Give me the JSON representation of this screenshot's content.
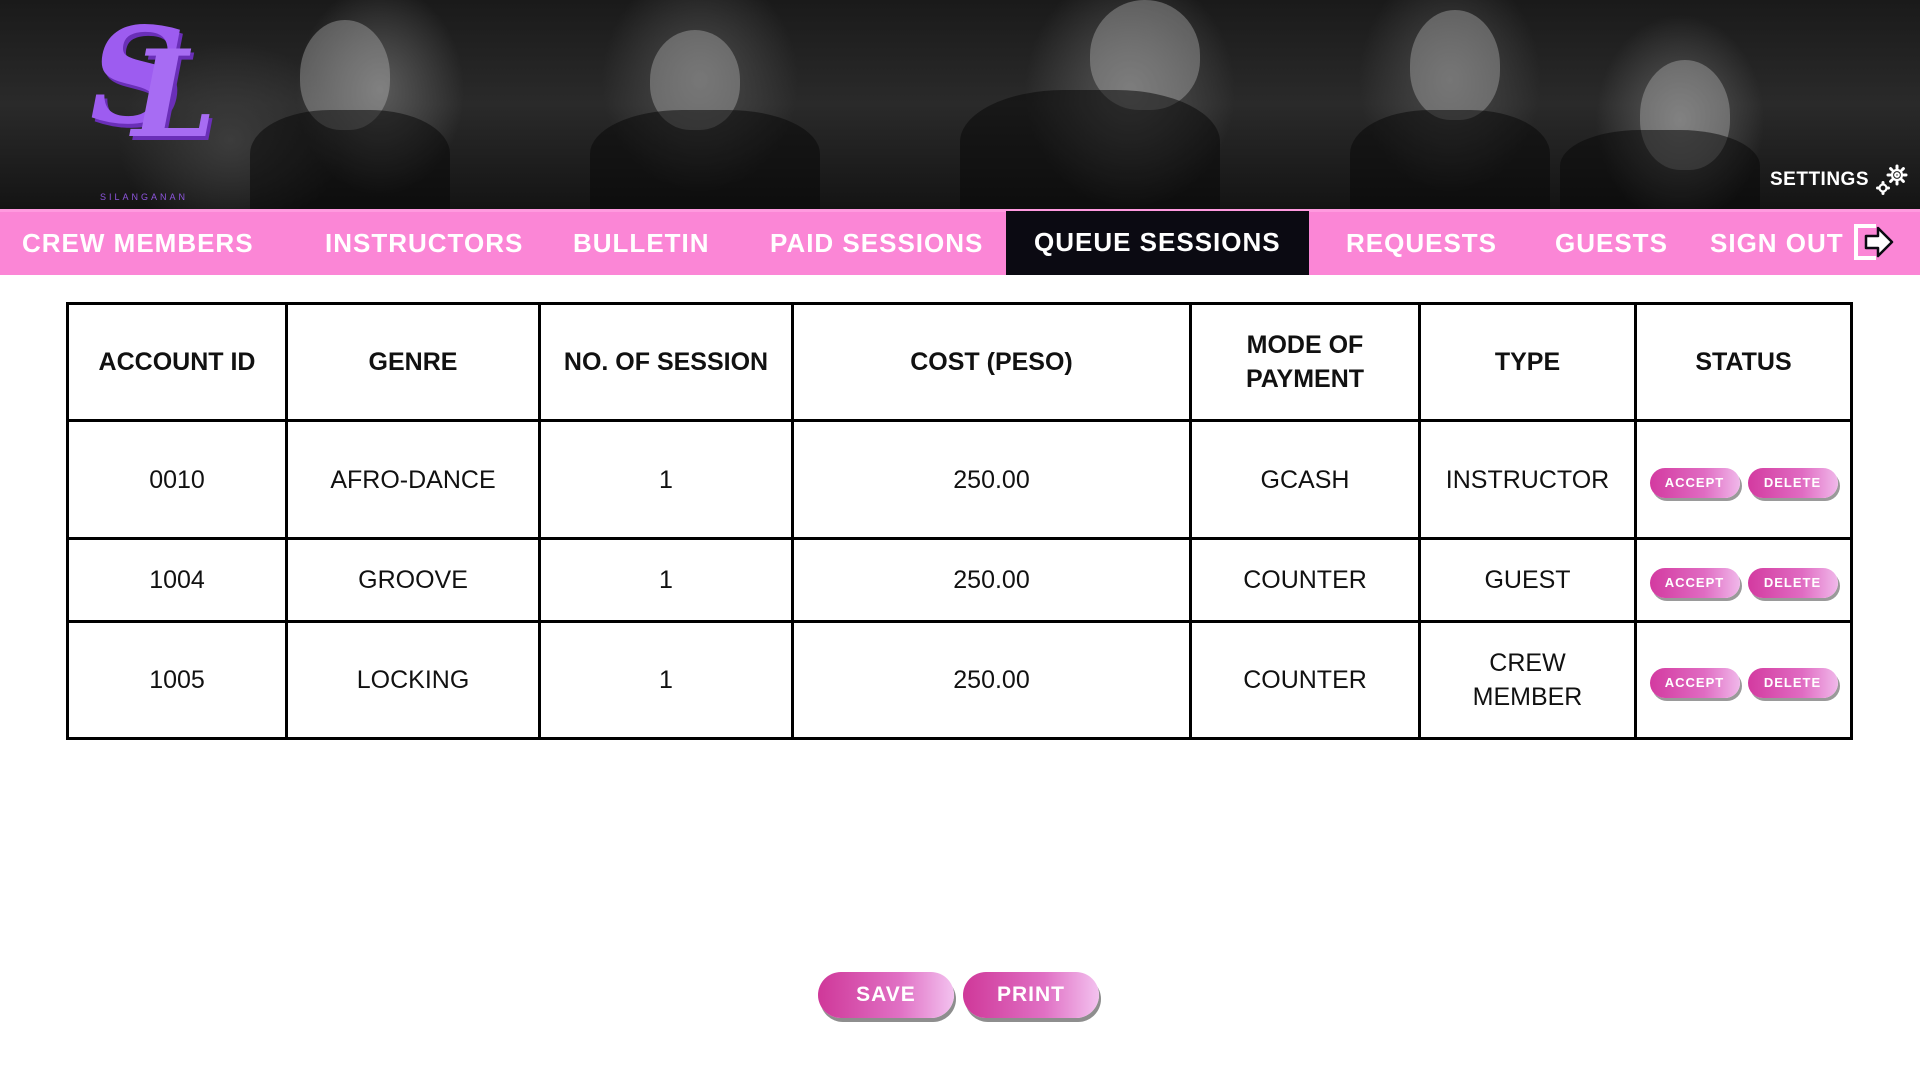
{
  "logo": {
    "mark": "SL",
    "subtitle": "SILANGANAN"
  },
  "settings": {
    "label": "SETTINGS",
    "icon": "gear-icon"
  },
  "nav": {
    "items": [
      {
        "label": "CREW MEMBERS"
      },
      {
        "label": "INSTRUCTORS"
      },
      {
        "label": "BULLETIN"
      },
      {
        "label": "PAID SESSIONS"
      },
      {
        "label": "QUEUE SESSIONS",
        "active": true
      },
      {
        "label": "REQUESTS"
      },
      {
        "label": "GUESTS"
      },
      {
        "label": "SIGN OUT",
        "icon": "sign-out-icon"
      }
    ]
  },
  "table": {
    "headers": [
      "ACCOUNT ID",
      "GENRE",
      "NO. OF SESSION",
      "COST (PESO)",
      "MODE OF PAYMENT",
      "TYPE",
      "STATUS"
    ],
    "rows": [
      {
        "account_id": "0010",
        "genre": "AFRO-DANCE",
        "sessions": "1",
        "cost": "250.00",
        "payment": "GCASH",
        "type": "INSTRUCTOR",
        "accept": "ACCEPT",
        "delete": "DELETE"
      },
      {
        "account_id": "1004",
        "genre": "GROOVE",
        "sessions": "1",
        "cost": "250.00",
        "payment": "COUNTER",
        "type": "GUEST",
        "accept": "ACCEPT",
        "delete": "DELETE"
      },
      {
        "account_id": "1005",
        "genre": "LOCKING",
        "sessions": "1",
        "cost": "250.00",
        "payment": "COUNTER",
        "type": "CREW MEMBER",
        "accept": "ACCEPT",
        "delete": "DELETE"
      }
    ]
  },
  "actions": {
    "save": "SAVE",
    "print": "PRINT"
  },
  "colors": {
    "nav_bg": "#fb86d6",
    "active_tab_bg": "#0b0a12",
    "logo_purple": "#9d5cf0",
    "button_pink": "#d33aa0"
  }
}
